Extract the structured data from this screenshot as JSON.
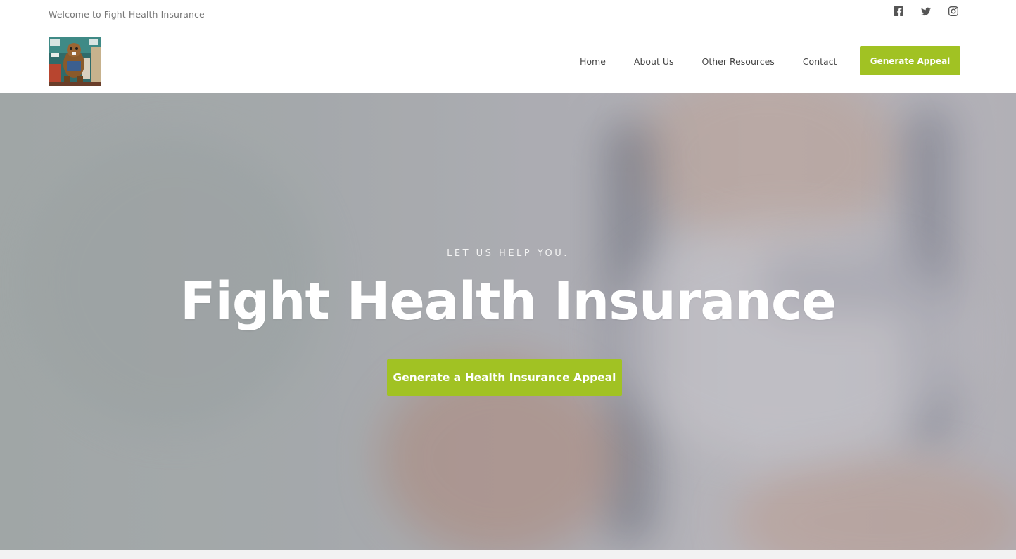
{
  "topbar": {
    "welcome_text": "Welcome to Fight Health Insurance",
    "social": [
      {
        "icon": "facebook-icon"
      },
      {
        "icon": "twitter-icon"
      },
      {
        "icon": "instagram-icon"
      }
    ]
  },
  "nav": {
    "links": [
      {
        "label": "Home"
      },
      {
        "label": "About Us"
      },
      {
        "label": "Other Resources"
      },
      {
        "label": "Contact"
      }
    ],
    "cta_label": "Generate Appeal"
  },
  "hero": {
    "kicker": "LET US HELP YOU.",
    "title": "Fight Health Insurance",
    "cta_label": "Generate a Health Insurance Appeal"
  },
  "colors": {
    "accent": "#a1c223",
    "nav_text": "#444444",
    "muted_text": "#777777"
  }
}
